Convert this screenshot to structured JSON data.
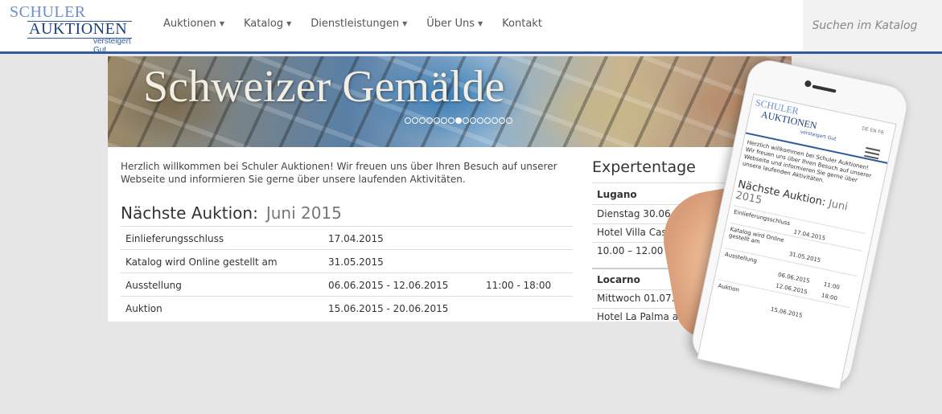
{
  "header": {
    "logo": {
      "line1": "SCHULER",
      "line2": "AUKTIONEN",
      "tagline": "versteigert Gut"
    },
    "nav": [
      {
        "label": "Auktionen",
        "dropdown": true
      },
      {
        "label": "Katalog",
        "dropdown": true
      },
      {
        "label": "Dienstleistungen",
        "dropdown": true
      },
      {
        "label": "Über Uns",
        "dropdown": true
      },
      {
        "label": "Kontakt",
        "dropdown": false
      }
    ],
    "search_placeholder": "Suchen im Katalog"
  },
  "banner": {
    "title": "Schweizer Gemälde",
    "slide_count": 15,
    "active_slide": 8
  },
  "welcome": "Herzlich willkommen bei Schuler Auktionen! Wir freuen uns über Ihren Besuch auf unserer Webseite und informieren Sie gerne über unsere laufenden Aktivitäten.",
  "next_auction": {
    "heading": "Nächste Auktion:",
    "date": "Juni 2015",
    "rows": [
      {
        "label": "Einlieferungsschluss",
        "date": "17.04.2015",
        "time": ""
      },
      {
        "label": "Katalog wird Online gestellt am",
        "date": "31.05.2015",
        "time": ""
      },
      {
        "label": "Ausstellung",
        "date": "06.06.2015 - 12.06.2015",
        "time": "11:00 - 18:00"
      },
      {
        "label": "Auktion",
        "date": "15.06.2015 - 20.06.2015",
        "time": ""
      }
    ]
  },
  "expertentage": {
    "title": "Expertentage",
    "entries": [
      {
        "city": "Lugano",
        "date": "Dienstag 30.06.2015",
        "place": "Hotel Villa Castagnola",
        "time": "10.00 – 12.00 & 13.00 – 17.00"
      },
      {
        "city": "Locarno",
        "date": "Mittwoch 01.07.2015",
        "place": "Hotel La Palma au Lac"
      }
    ]
  },
  "mobile": {
    "langs": "DE EN FR",
    "text": "Herzlich willkommen bei Schuler Auktionen! Wir freuen uns über Ihren Besuch auf unserer Webseite und informieren Sie gerne über unsere laufenden Aktivitäten.",
    "heading": "Nächste Auktion:",
    "heading_date_1": "Juni",
    "heading_date_2": "2015",
    "rows": [
      {
        "label": "Einlieferungsschluss",
        "value": "17.04.2015"
      },
      {
        "label": "Katalog wird Online gestellt am",
        "value": "31.05.2015"
      },
      {
        "label": "Ausstellung",
        "value": "06.06.2015",
        "value2": "12.06.2015",
        "time1": "11:00",
        "time2": "18:00"
      },
      {
        "label": "Auktion",
        "value": "15.06.2015"
      }
    ]
  }
}
